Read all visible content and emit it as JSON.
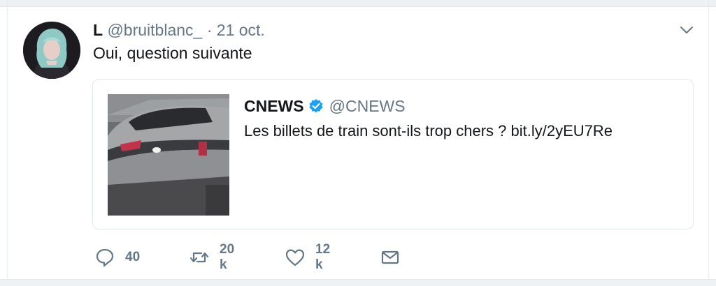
{
  "tweet": {
    "author_name": "L",
    "author_handle": "@bruitblanc_",
    "separator": "·",
    "date": "21 oct.",
    "text": "Oui, question suivante"
  },
  "quoted": {
    "name": "CNEWS",
    "handle": "@CNEWS",
    "text": "Les billets de train sont-ils trop chers ? bit.ly/2yEU7Re",
    "verified": true
  },
  "actions": {
    "replies": "40",
    "retweets": "20 k",
    "likes": "12 k"
  },
  "icons": {
    "reply": "reply-icon",
    "retweet": "retweet-icon",
    "like": "heart-icon",
    "message": "envelope-icon",
    "menu": "chevron-down-icon",
    "verified": "verified-badge-icon"
  },
  "colors": {
    "text": "#14171a",
    "muted": "#657786",
    "verified": "#1da1f2",
    "border": "#e1e8ed"
  }
}
